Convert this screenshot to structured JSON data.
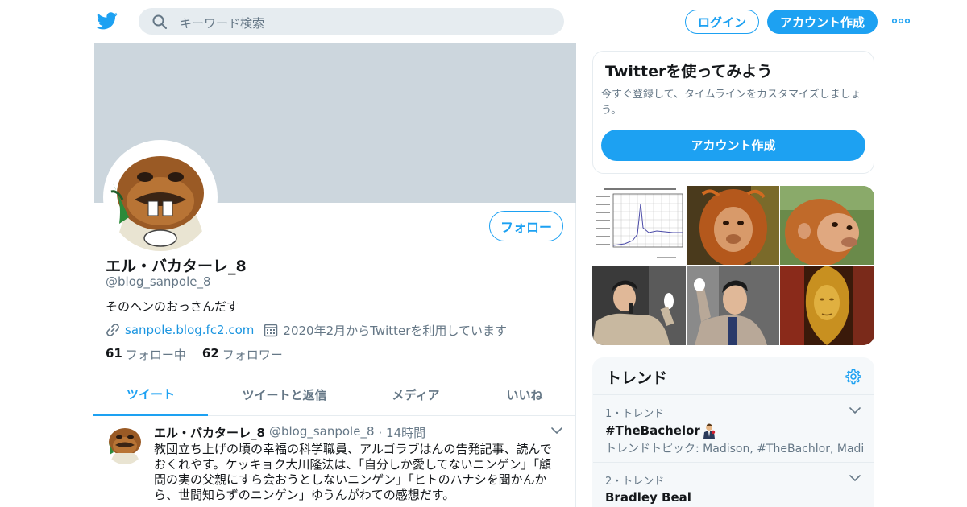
{
  "colors": {
    "brand": "#1da1f2",
    "banner": "#ccd6dd",
    "secondary_text": "#657786",
    "trends_bg": "#f5f8fa"
  },
  "header": {
    "logo_icon": "twitter-bird-icon",
    "search_placeholder": "キーワード検索",
    "login_label": "ログイン",
    "signup_label": "アカウント作成",
    "more_icon": "more-dots-icon"
  },
  "profile": {
    "name": "エル・バカターレ_8",
    "handle": "@blog_sanpole_8",
    "bio": "そのヘンのおっさんだす",
    "website": "sanpole.blog.fc2.com",
    "joined": "2020年2月からTwitterを利用しています",
    "following_count": "61",
    "following_label": "フォロー中",
    "followers_count": "62",
    "followers_label": "フォロワー",
    "follow_button": "フォロー"
  },
  "tabs": [
    {
      "label": "ツイート",
      "active": true
    },
    {
      "label": "ツイートと返信",
      "active": false
    },
    {
      "label": "メディア",
      "active": false
    },
    {
      "label": "いいね",
      "active": false
    }
  ],
  "tweet": {
    "author_name": "エル・バカターレ_8",
    "author_handle": "@blog_sanpole_8",
    "time": "· 14時間",
    "text": "教団立ち上げの頃の幸福の科学職員、アルゴラブはんの告発記事、読んでおくれやす。ケッキョク大川隆法は、「自分しか愛してないニンゲン」「顧問の実の父親にすら会おうとしないニンゲン」「ヒトのハナシを聞かんから、世間知らずのニンゲン」ゆうんがわての感想だす。"
  },
  "signup_card": {
    "title": "Twitterを使ってみよう",
    "description": "今すぐ登録して、タイムラインをカスタマイズしましょう。",
    "button": "アカウント作成"
  },
  "media_images": [
    "line-chart-thumbnail",
    "orangutan-photo",
    "orangutan-photo",
    "speaker-photo",
    "speaker-photo",
    "golden-statue-photo"
  ],
  "trends": {
    "title": "トレンド",
    "items": [
      {
        "meta": "1・トレンド",
        "name": "#TheBachelor",
        "description": "トレンドトピック: Madison, #TheBachlor, Madi"
      },
      {
        "meta": "2・トレンド",
        "name": "Bradley Beal",
        "description": ""
      }
    ]
  }
}
